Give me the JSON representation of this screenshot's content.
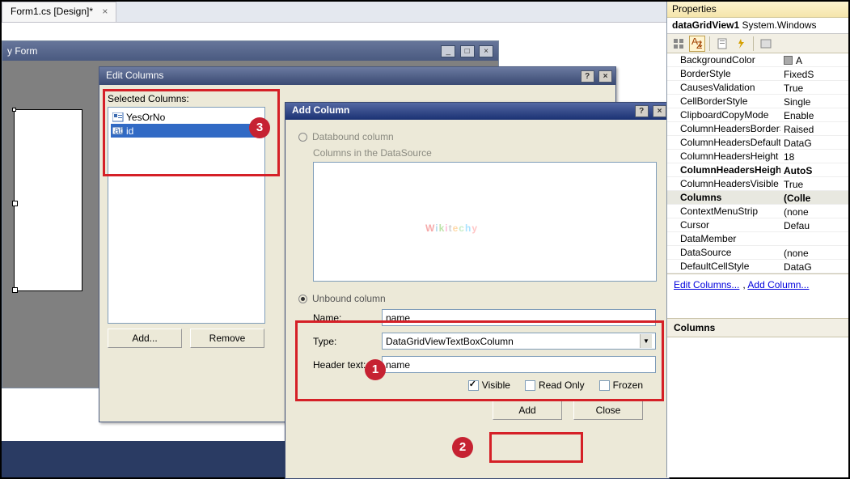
{
  "tab": {
    "label": "Form1.cs [Design]*"
  },
  "form_window": {
    "title": "y Form"
  },
  "edit_columns": {
    "title": "Edit Columns",
    "selected_label": "Selected Columns:",
    "items": [
      {
        "label": "YesOrNo",
        "icon": "checkbox-col"
      },
      {
        "label": "id",
        "icon": "textbox-col"
      }
    ],
    "add_btn": "Add...",
    "remove_btn": "Remove"
  },
  "add_column": {
    "title": "Add Column",
    "databound_label": "Databound column",
    "sub_label": "Columns in the DataSource",
    "unbound_label": "Unbound column",
    "name_label": "Name:",
    "name_value": "name",
    "type_label": "Type:",
    "type_value": "DataGridViewTextBoxColumn",
    "header_label": "Header text:",
    "header_value": "name",
    "visible_label": "Visible",
    "readonly_label": "Read Only",
    "frozen_label": "Frozen",
    "add_btn": "Add",
    "close_btn": "Close"
  },
  "badges": {
    "one": "1",
    "two": "2",
    "three": "3"
  },
  "properties": {
    "title": "Properties",
    "object": "dataGridView1",
    "type": "System.Windows",
    "rows": [
      {
        "k": "BackgroundColor",
        "v": "A",
        "swatch": true
      },
      {
        "k": "BorderStyle",
        "v": "FixedS"
      },
      {
        "k": "CausesValidation",
        "v": "True"
      },
      {
        "k": "CellBorderStyle",
        "v": "Single"
      },
      {
        "k": "ClipboardCopyMode",
        "v": "Enable"
      },
      {
        "k": "ColumnHeadersBorderSt",
        "v": "Raised"
      },
      {
        "k": "ColumnHeadersDefaultCe",
        "v": "DataG"
      },
      {
        "k": "ColumnHeadersHeight",
        "v": "18"
      },
      {
        "k": "ColumnHeadersHeightSiz",
        "v": "AutoS",
        "bold": true
      },
      {
        "k": "ColumnHeadersVisible",
        "v": "True"
      },
      {
        "k": "Columns",
        "v": "(Colle",
        "bold": true,
        "hl": true
      },
      {
        "k": "ContextMenuStrip",
        "v": "(none"
      },
      {
        "k": "Cursor",
        "v": "Defau"
      },
      {
        "k": "DataMember",
        "v": ""
      },
      {
        "k": "DataSource",
        "v": "(none"
      },
      {
        "k": "DefaultCellStyle",
        "v": "DataG"
      }
    ],
    "link1": "Edit Columns...",
    "link2": "Add Column...",
    "category": "Columns"
  }
}
